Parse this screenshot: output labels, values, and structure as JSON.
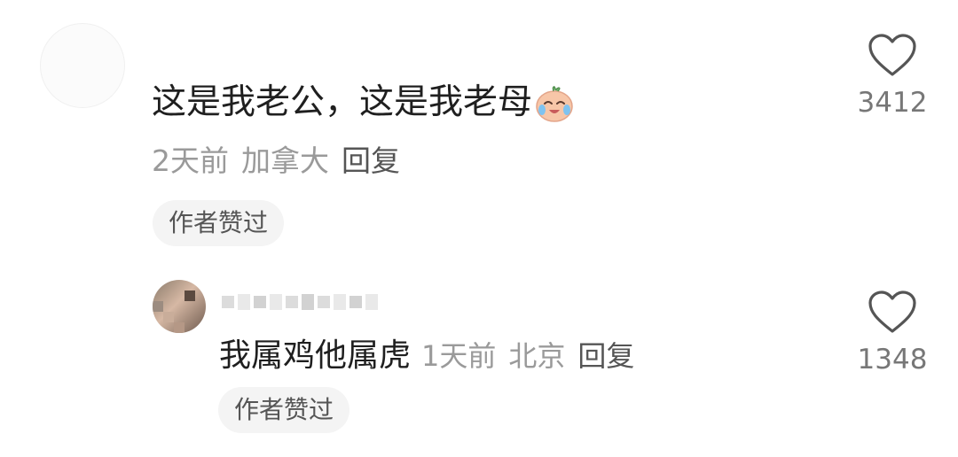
{
  "comment": {
    "text": "这是我老公，这是我老母",
    "emoji": "crying-face-emoji",
    "time": "2天前",
    "location": "加拿大",
    "reply_label": "回复",
    "author_liked": "作者赞过",
    "like_count": "3412"
  },
  "reply": {
    "text": "我属鸡他属虎",
    "time": "1天前",
    "location": "北京",
    "reply_label": "回复",
    "author_liked": "作者赞过",
    "like_count": "1348"
  },
  "colors": {
    "text_primary": "#1f1f1f",
    "text_meta": "#9a9a9a",
    "badge_bg": "#f4f4f4",
    "heart_stroke": "#555555"
  }
}
